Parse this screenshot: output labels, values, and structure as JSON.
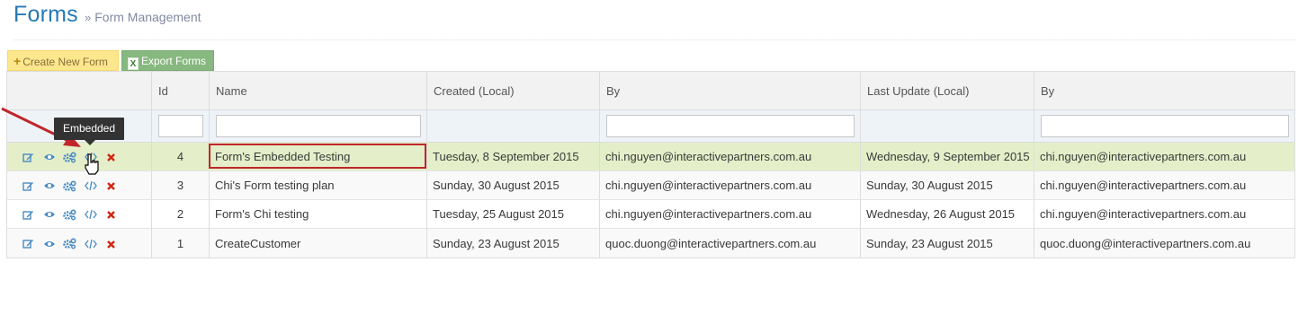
{
  "header": {
    "title": "Forms",
    "breadcrumb_sep": "»",
    "subtitle": "Form Management"
  },
  "toolbar": {
    "create_label": "Create New Form",
    "export_label": "Export Forms"
  },
  "table": {
    "headers": [
      "",
      "Id",
      "Name",
      "Created (Local)",
      "By",
      "Last Update (Local)",
      "By"
    ],
    "rows": [
      {
        "id": "4",
        "name": "Form's Embedded Testing",
        "created": "Tuesday, 8 September 2015",
        "created_by": "chi.nguyen@interactivepartners.com.au",
        "updated": "Wednesday, 9 September 2015",
        "updated_by": "chi.nguyen@interactivepartners.com.au"
      },
      {
        "id": "3",
        "name": "Chi's Form testing plan",
        "created": "Sunday, 30 August 2015",
        "created_by": "chi.nguyen@interactivepartners.com.au",
        "updated": "Sunday, 30 August 2015",
        "updated_by": "chi.nguyen@interactivepartners.com.au"
      },
      {
        "id": "2",
        "name": "Form's Chi testing",
        "created": "Tuesday, 25 August 2015",
        "created_by": "chi.nguyen@interactivepartners.com.au",
        "updated": "Wednesday, 26 August 2015",
        "updated_by": "chi.nguyen@interactivepartners.com.au"
      },
      {
        "id": "1",
        "name": "CreateCustomer",
        "created": "Sunday, 23 August 2015",
        "created_by": "quoc.duong@interactivepartners.com.au",
        "updated": "Sunday, 23 August 2015",
        "updated_by": "quoc.duong@interactivepartners.com.au"
      }
    ],
    "row_actions": [
      "edit-icon",
      "view-icon",
      "settings-icon",
      "embed-code-icon",
      "delete-icon"
    ]
  },
  "tooltip": {
    "text": "Embedded"
  },
  "colors": {
    "title": "#2679b5",
    "selected_row": "#e4efc9",
    "highlight_box": "#c0262a",
    "create_button": "#fce78c",
    "export_button": "#87b87f"
  }
}
